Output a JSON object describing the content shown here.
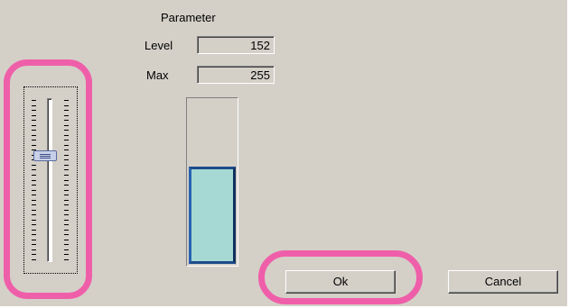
{
  "parameter": {
    "title": "Parameter",
    "level_label": "Level",
    "level_value": "152",
    "max_label": "Max",
    "max_value": "255"
  },
  "gauge": {
    "level": 152,
    "max": 255,
    "fill_color": "#a6d9d3",
    "border_color": "#1d4a8a"
  },
  "slider": {
    "value": 152,
    "max": 255,
    "tick_count": 33
  },
  "buttons": {
    "ok_label": "Ok",
    "cancel_label": "Cancel"
  },
  "annotations": {
    "highlight_color": "#ef5fa9"
  }
}
